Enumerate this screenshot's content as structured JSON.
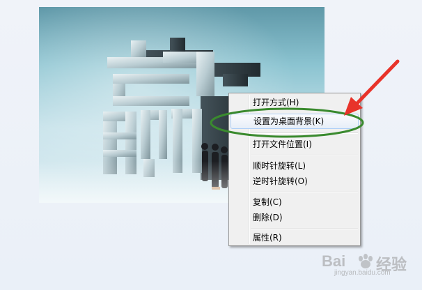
{
  "image": {
    "glyph": "赢",
    "alt": "3D character sculpture with business people"
  },
  "context_menu": {
    "items": [
      {
        "label": "打开方式(H)",
        "has_submenu": true
      },
      {
        "label": "设置为桌面背景(K)",
        "highlighted": true
      },
      {
        "label": "打开文件位置(I)"
      },
      {
        "label": "顺时针旋转(L)"
      },
      {
        "label": "逆时针旋转(O)"
      },
      {
        "label": "复制(C)"
      },
      {
        "label": "删除(D)"
      },
      {
        "label": "属性(R)"
      }
    ]
  },
  "annotation": {
    "circle_color": "#3a8a2e",
    "arrow_color": "#e8332a"
  },
  "watermark": {
    "brand": "Bai",
    "suffix": "经验",
    "url": "jingyan.baidu.com"
  }
}
